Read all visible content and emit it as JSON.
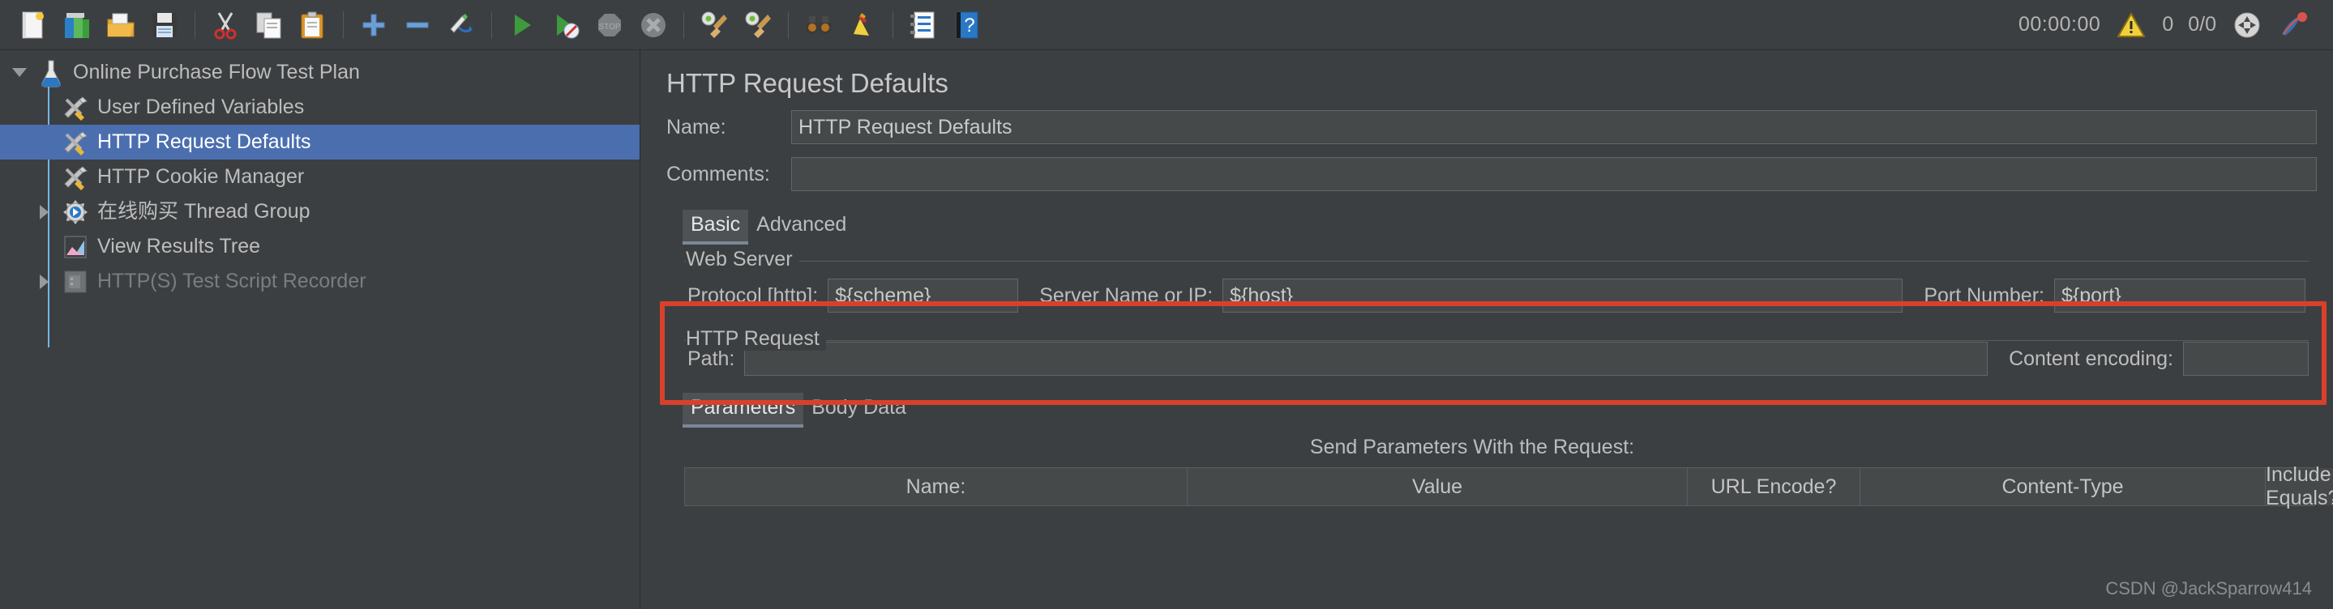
{
  "toolbar": {
    "icons": [
      {
        "name": "new-icon",
        "label": "New"
      },
      {
        "name": "templates-icon",
        "label": "Templates"
      },
      {
        "name": "open-icon",
        "label": "Open"
      },
      {
        "name": "save-icon",
        "label": "Save Test Plan"
      },
      {
        "name": "cut-icon",
        "label": "Cut"
      },
      {
        "name": "copy-icon",
        "label": "Copy"
      },
      {
        "name": "paste-icon",
        "label": "Paste"
      },
      {
        "name": "expand-all-icon",
        "label": "Expand All"
      },
      {
        "name": "collapse-all-icon",
        "label": "Collapse All"
      },
      {
        "name": "toggle-icon",
        "label": "Toggle"
      },
      {
        "name": "start-icon",
        "label": "Start"
      },
      {
        "name": "start-no-timers-icon",
        "label": "Start no pauses"
      },
      {
        "name": "stop-icon",
        "label": "Stop"
      },
      {
        "name": "shutdown-icon",
        "label": "Shutdown"
      },
      {
        "name": "clear-icon",
        "label": "Clear"
      },
      {
        "name": "clear-all-icon",
        "label": "Clear All"
      },
      {
        "name": "search-icon",
        "label": "Search"
      },
      {
        "name": "reset-search-icon",
        "label": "Reset Search"
      },
      {
        "name": "function-helper-icon",
        "label": "Function Helper Dialog"
      },
      {
        "name": "help-icon",
        "label": "Help"
      }
    ],
    "status": {
      "timer": "00:00:00",
      "warning_count": "0",
      "threads": "0/0",
      "warning_icon": "warning-triangle-icon",
      "connection_icon": "connection-icon",
      "jmeter_icon": "jmeter-feather-icon"
    }
  },
  "tree": {
    "items": [
      {
        "label": "Online Purchase Flow Test Plan",
        "icon": "test-plan-flask-icon",
        "toggle": "down",
        "indent": 0,
        "selected": false,
        "disabled": false
      },
      {
        "label": "User Defined Variables",
        "icon": "config-element-icon",
        "toggle": "none",
        "indent": 1,
        "selected": false,
        "disabled": false
      },
      {
        "label": "HTTP Request Defaults",
        "icon": "config-element-icon",
        "toggle": "none",
        "indent": 1,
        "selected": true,
        "disabled": false
      },
      {
        "label": "HTTP Cookie Manager",
        "icon": "config-element-icon",
        "toggle": "none",
        "indent": 1,
        "selected": false,
        "disabled": false
      },
      {
        "label": "在线购买 Thread Group",
        "icon": "thread-group-gear-icon",
        "toggle": "right",
        "indent": 1,
        "selected": false,
        "disabled": false
      },
      {
        "label": "View Results Tree",
        "icon": "listener-chart-icon",
        "toggle": "none",
        "indent": 1,
        "selected": false,
        "disabled": false
      },
      {
        "label": "HTTP(S) Test Script Recorder",
        "icon": "recorder-icon",
        "toggle": "right",
        "indent": 1,
        "selected": false,
        "disabled": true
      }
    ]
  },
  "panel": {
    "title": "HTTP Request Defaults",
    "name_label": "Name:",
    "name_value": "HTTP Request Defaults",
    "comments_label": "Comments:",
    "comments_value": "",
    "tabs": [
      {
        "label": "Basic",
        "active": true
      },
      {
        "label": "Advanced",
        "active": false
      }
    ],
    "web_server": {
      "legend": "Web Server",
      "protocol_label": "Protocol [http]:",
      "protocol_value": "${scheme}",
      "server_label": "Server Name or IP:",
      "server_value": "${host}",
      "port_label": "Port Number:",
      "port_value": "${port}",
      "highlight_color": "#d9402c"
    },
    "http_request": {
      "legend": "HTTP Request",
      "path_label": "Path:",
      "path_value": "",
      "content_encoding_label": "Content encoding:",
      "content_encoding_value": ""
    },
    "sub_tabs": [
      {
        "label": "Parameters",
        "active": true
      },
      {
        "label": "Body Data",
        "active": false
      }
    ],
    "send_params_title": "Send Parameters With the Request:",
    "param_table": {
      "columns": [
        "Name:",
        "Value",
        "URL Encode?",
        "Content-Type",
        "Include Equals?"
      ],
      "rows": []
    }
  },
  "watermark": "CSDN @JackSparrow414"
}
